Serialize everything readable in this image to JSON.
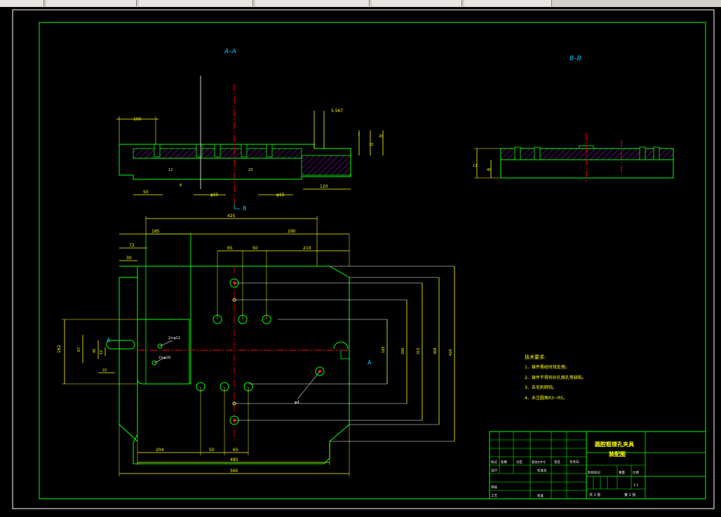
{
  "taskbar": {
    "tabs": [
      "",
      "",
      "",
      "",
      "",
      ""
    ]
  },
  "drawing": {
    "section_aa_label": "A–A",
    "section_bb_label": "B–B",
    "aa_dims": [
      "100",
      "5.567",
      "50",
      "φ15",
      "φ15",
      "120",
      "7",
      "10",
      "20",
      "12",
      "8",
      "23"
    ],
    "cut_marker": "B",
    "bb_dims": [
      "12",
      "40"
    ],
    "plan_dims": {
      "top": [
        "425",
        "185",
        "290",
        "72",
        "65",
        "50",
        "210",
        "30"
      ],
      "left": [
        "162",
        "67",
        "40",
        "15",
        "22"
      ],
      "right": [
        "165",
        "290",
        "315",
        "368",
        "420"
      ],
      "bottom": [
        "204",
        "50",
        "65",
        "485",
        "560"
      ],
      "callouts": [
        "2×φ12",
        "2×φ16",
        "φ4"
      ],
      "section_marks": [
        "A",
        "A"
      ]
    },
    "tech_requirements": {
      "title": "技术要求:",
      "items": [
        "1、铸件需经时效处理。",
        "2、铸件不得有砂孔缩孔等缺陷。",
        "3、去毛刺倒钝。",
        "4、未注圆角R3~R5。"
      ]
    },
    "title_block": {
      "title_line1": "圆腔粗镗孔夹具",
      "title_line2": "装配图",
      "left_headers": [
        "标记",
        "处数",
        "分区",
        "更改文件号",
        "签名",
        "年月日"
      ],
      "row_labels": [
        "设计",
        "标准化",
        "审核",
        "工艺",
        "批准"
      ],
      "right_labels": [
        "阶段标记",
        "重量",
        "比例",
        "1:1"
      ],
      "sheet_info": [
        "共 1 张",
        "第 1 张"
      ]
    }
  },
  "colors": {
    "frame": "#00ff00",
    "dims": "#ffff00",
    "center": "#ff0000",
    "hatch": "#c000ff",
    "label": "#00c8ff",
    "white": "#ffffff"
  }
}
